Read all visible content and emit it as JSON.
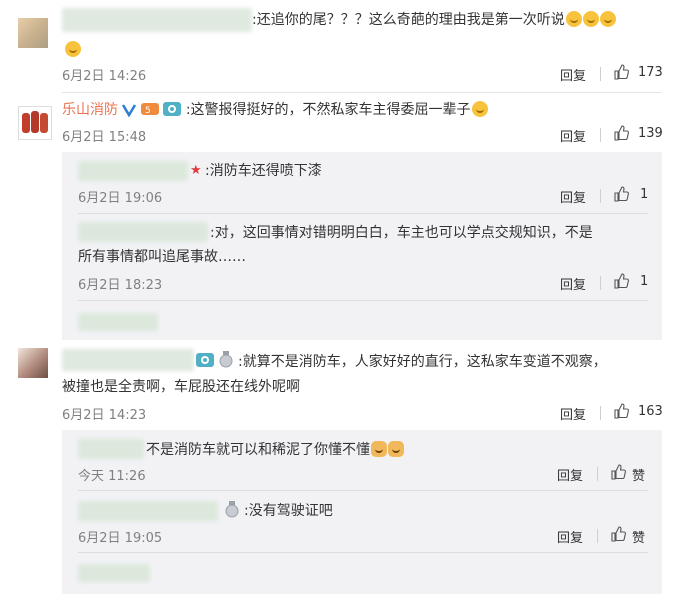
{
  "comments": [
    {
      "user": "",
      "text": ":还追你的尾？？？这么奇葩的理由我是第一次听说",
      "time": "6月2日 14:26",
      "reply_label": "回复",
      "likes": "173"
    },
    {
      "user": "乐山消防",
      "text": ":这警报得挺好的，不然私家车主得委屈一辈子",
      "time": "6月2日 15:48",
      "reply_label": "回复",
      "likes": "139",
      "replies": [
        {
          "text": ":消防车还得喷下漆",
          "time": "6月2日 19:06",
          "reply_label": "回复",
          "likes": "1"
        },
        {
          "text_line1": ":对，这回事情对错明明白白，车主也可以学点交规知识，不是",
          "text_line2": "所有事情都叫追尾事故……",
          "time": "6月2日 18:23",
          "reply_label": "回复",
          "likes": "1"
        }
      ]
    },
    {
      "user": "",
      "text_line1": ":就算不是消防车，人家好好的直行，这私家车变道不观察，",
      "text_line2": "被撞也是全责啊，车屁股还在线外呢啊",
      "time": "6月2日 14:23",
      "reply_label": "回复",
      "likes": "163",
      "replies": [
        {
          "text": "不是消防车就可以和稀泥了你懂不懂",
          "time": "今天 11:26",
          "reply_label": "回复",
          "likes": "赞"
        },
        {
          "text": ":没有驾驶证吧",
          "time": "6月2日 19:05",
          "reply_label": "回复",
          "likes": "赞"
        }
      ]
    }
  ],
  "colors": {
    "username_orange": "#eb7350",
    "verified_blue": "#2d7dd2",
    "panel_bg": "#f2f2f5"
  },
  "icons": [
    "thumbs-up-icon",
    "verified-icon",
    "camera-icon",
    "medal-icon",
    "emoji-icon"
  ]
}
